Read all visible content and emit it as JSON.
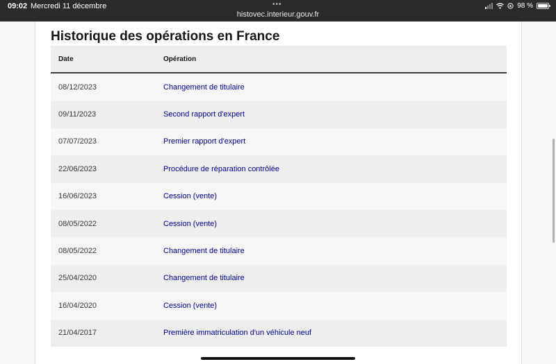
{
  "status_bar": {
    "time": "09:02",
    "date": "Mercredi 11 décembre",
    "url": "histovec.interieur.gouv.fr",
    "battery": "98 %",
    "dots": "•••"
  },
  "page": {
    "title": "Historique des opérations en France",
    "table": {
      "headers": {
        "date": "Date",
        "operation": "Opération"
      },
      "rows": [
        {
          "date": "08/12/2023",
          "operation": "Changement de titulaire"
        },
        {
          "date": "09/11/2023",
          "operation": "Second rapport d'expert"
        },
        {
          "date": "07/07/2023",
          "operation": "Premier rapport d'expert"
        },
        {
          "date": "22/06/2023",
          "operation": "Procédure de réparation contrôlée"
        },
        {
          "date": "16/06/2023",
          "operation": "Cession (vente)"
        },
        {
          "date": "08/05/2022",
          "operation": "Cession (vente)"
        },
        {
          "date": "08/05/2022",
          "operation": "Changement de titulaire"
        },
        {
          "date": "25/04/2020",
          "operation": "Changement de titulaire"
        },
        {
          "date": "16/04/2020",
          "operation": "Cession (vente)"
        },
        {
          "date": "21/04/2017",
          "operation": "Première immatriculation d'un véhicule neuf"
        }
      ]
    }
  },
  "colors": {
    "link": "#000091",
    "row_odd": "#f6f6f6",
    "row_even": "#eeeeee",
    "status_bar": "#2b2b2b"
  }
}
